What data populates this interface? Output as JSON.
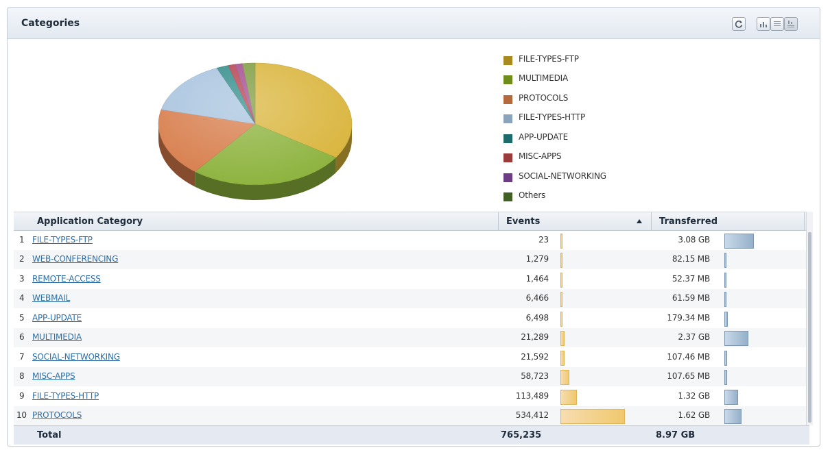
{
  "panel": {
    "title": "Categories",
    "toolbar": [
      {
        "name": "refresh-button",
        "icon": "refresh-icon"
      },
      {
        "name": "bar-chart-view-button",
        "icon": "bar-chart-icon"
      },
      {
        "name": "table-view-button",
        "icon": "table-icon"
      },
      {
        "name": "chart-and-table-view-button",
        "icon": "chart-table-icon"
      }
    ]
  },
  "chart_data": {
    "type": "pie",
    "title": "",
    "legend_position": "right",
    "slices": [
      {
        "label": "FILE-TYPES-FTP",
        "value": 34.3,
        "color": "#d9b43a"
      },
      {
        "label": "MULTIMEDIA",
        "value": 26.4,
        "color": "#8cb23c"
      },
      {
        "label": "PROTOCOLS",
        "value": 18.1,
        "color": "#d77c4a"
      },
      {
        "label": "FILE-TYPES-HTTP",
        "value": 14.7,
        "color": "#a7c3de"
      },
      {
        "label": "APP-UPDATE",
        "value": 2.0,
        "color": "#2f8b89"
      },
      {
        "label": "MISC-APPS",
        "value": 1.2,
        "color": "#b5404d"
      },
      {
        "label": "SOCIAL-NETWORKING",
        "value": 1.2,
        "color": "#a34a8e"
      },
      {
        "label": "Others",
        "value": 2.1,
        "color": "#7d9b3f"
      }
    ]
  },
  "legend": [
    {
      "label": "FILE-TYPES-FTP",
      "color": "#a88a1e"
    },
    {
      "label": "MULTIMEDIA",
      "color": "#6e8d1d"
    },
    {
      "label": "PROTOCOLS",
      "color": "#b46a3c"
    },
    {
      "label": "FILE-TYPES-HTTP",
      "color": "#8aa4bd"
    },
    {
      "label": "APP-UPDATE",
      "color": "#1e6b6b"
    },
    {
      "label": "MISC-APPS",
      "color": "#9b3b3b"
    },
    {
      "label": "SOCIAL-NETWORKING",
      "color": "#6e3c86"
    },
    {
      "label": "Others",
      "color": "#3f5f23"
    }
  ],
  "table": {
    "columns": {
      "category": "Application Category",
      "events": "Events",
      "transferred": "Transferred"
    },
    "sort": {
      "column": "events",
      "direction": "ascending"
    },
    "rows": [
      {
        "rank": "1",
        "category": "FILE-TYPES-FTP",
        "events": "23",
        "events_pct": 0.01,
        "transferred": "3.08 GB",
        "transferred_pct": 0.47
      },
      {
        "rank": "2",
        "category": "WEB-CONFERENCING",
        "events": "1,279",
        "events_pct": 0.01,
        "transferred": "82.15 MB",
        "transferred_pct": 0.03
      },
      {
        "rank": "3",
        "category": "REMOTE-ACCESS",
        "events": "1,464",
        "events_pct": 0.01,
        "transferred": "52.37 MB",
        "transferred_pct": 0.03
      },
      {
        "rank": "4",
        "category": "WEBMAIL",
        "events": "6,466",
        "events_pct": 0.02,
        "transferred": "61.59 MB",
        "transferred_pct": 0.03
      },
      {
        "rank": "5",
        "category": "APP-UPDATE",
        "events": "6,498",
        "events_pct": 0.02,
        "transferred": "179.34 MB",
        "transferred_pct": 0.05
      },
      {
        "rank": "6",
        "category": "MULTIMEDIA",
        "events": "21,289",
        "events_pct": 0.06,
        "transferred": "2.37 GB",
        "transferred_pct": 0.38
      },
      {
        "rank": "7",
        "category": "SOCIAL-NETWORKING",
        "events": "21,592",
        "events_pct": 0.06,
        "transferred": "107.46 MB",
        "transferred_pct": 0.04
      },
      {
        "rank": "8",
        "category": "MISC-APPS",
        "events": "58,723",
        "events_pct": 0.14,
        "transferred": "107.65 MB",
        "transferred_pct": 0.04
      },
      {
        "rank": "9",
        "category": "FILE-TYPES-HTTP",
        "events": "113,489",
        "events_pct": 0.25,
        "transferred": "1.32 GB",
        "transferred_pct": 0.22
      },
      {
        "rank": "10",
        "category": "PROTOCOLS",
        "events": "534,412",
        "events_pct": 1.0,
        "transferred": "1.62 GB",
        "transferred_pct": 0.27
      }
    ],
    "total": {
      "label": "Total",
      "events": "765,235",
      "transferred": "8.97 GB"
    }
  }
}
